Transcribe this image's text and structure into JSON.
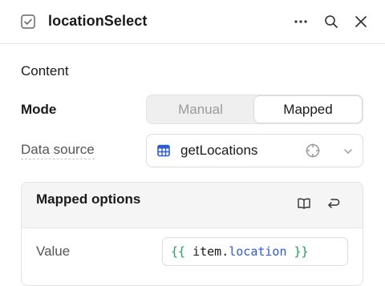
{
  "header": {
    "title": "locationSelect",
    "icons": {
      "checkbox": "checkbox-icon",
      "more": "more-icon",
      "search": "search-icon",
      "close": "close-icon"
    }
  },
  "content": {
    "section_label": "Content",
    "mode": {
      "label": "Mode",
      "options": [
        "Manual",
        "Mapped"
      ],
      "selected": "Mapped"
    },
    "data_source": {
      "label": "Data source",
      "value": "getLocations",
      "icons": {
        "leading": "table-icon",
        "action": "crosshair-icon",
        "dropdown": "chevron-down-icon"
      }
    },
    "mapped_options": {
      "title": "Mapped options",
      "icons": {
        "docs": "book-icon",
        "reset": "return-icon"
      },
      "value": {
        "label": "Value",
        "open": "{{",
        "object": "item",
        "separator": ".",
        "property": "location",
        "close": "}}"
      }
    }
  },
  "colors": {
    "brace": "#1aa05a",
    "property": "#2b5bd7",
    "table_icon": "#2b5bd7",
    "border": "#dcdcdc",
    "panel_header": "#f5f5f5"
  }
}
